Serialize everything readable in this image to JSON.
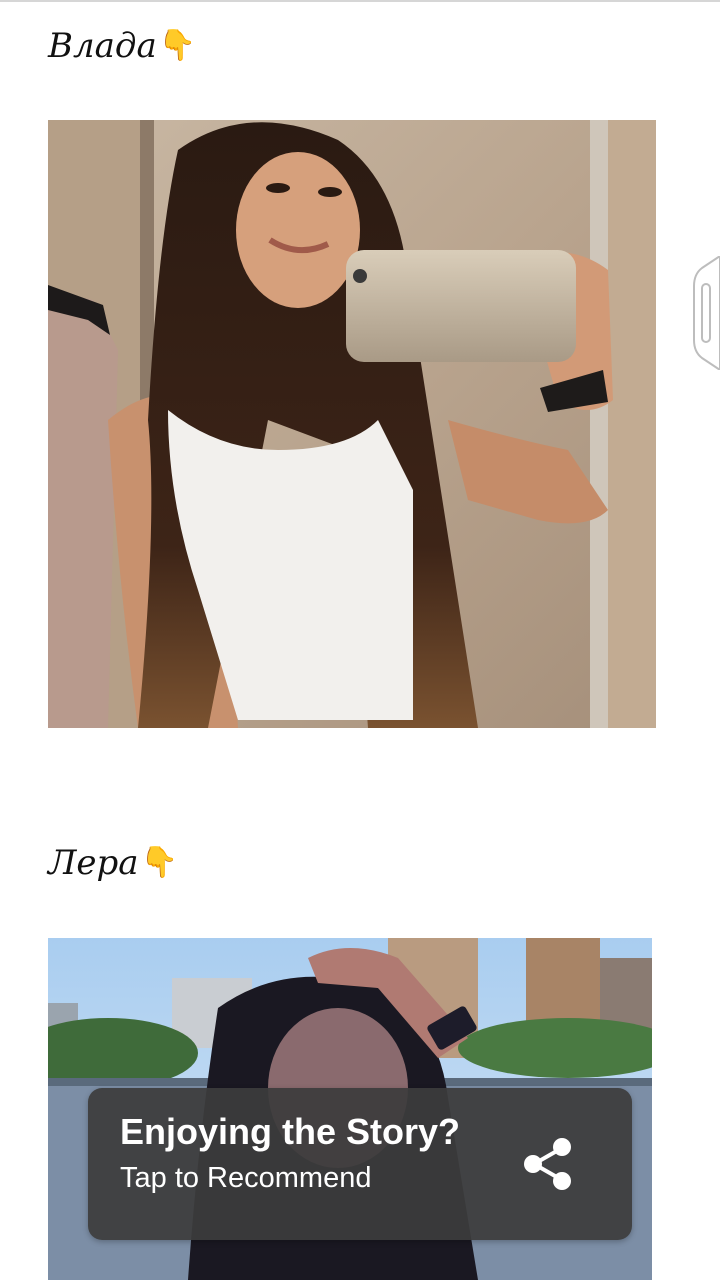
{
  "posts": [
    {
      "name": "Влада",
      "pointer_emoji": "👇"
    },
    {
      "name": "Лера",
      "pointer_emoji": "👇"
    }
  ],
  "recommend_toast": {
    "title": "Enjoying the Story?",
    "subtitle": "Tap to Recommend",
    "icon": "share-icon"
  },
  "colors": {
    "toast_bg": "#3c3c3c",
    "text": "#111111"
  }
}
